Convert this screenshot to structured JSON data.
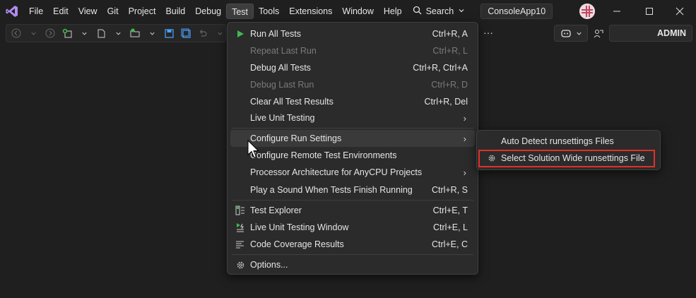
{
  "menubar": {
    "items": [
      "File",
      "Edit",
      "View",
      "Git",
      "Project",
      "Build",
      "Debug",
      "Test",
      "Tools",
      "Extensions",
      "Window",
      "Help"
    ],
    "active_item": "Test",
    "search_label": "Search",
    "solution_name": "ConsoleApp10"
  },
  "toolbar": {
    "account_label": "ADMIN",
    "more_label": "···"
  },
  "test_menu": {
    "items": [
      {
        "label": "Run All Tests",
        "shortcut": "Ctrl+R, A",
        "icon": "run-icon",
        "disabled": false
      },
      {
        "label": "Repeat Last Run",
        "shortcut": "Ctrl+R, L",
        "disabled": true
      },
      {
        "label": "Debug All Tests",
        "shortcut": "Ctrl+R, Ctrl+A",
        "disabled": false
      },
      {
        "label": "Debug Last Run",
        "shortcut": "Ctrl+R, D",
        "disabled": true
      },
      {
        "label": "Clear All Test Results",
        "shortcut": "Ctrl+R, Del",
        "disabled": false
      },
      {
        "label": "Live Unit Testing",
        "shortcut": "",
        "submenu": true
      },
      {
        "label": "Configure Run Settings",
        "shortcut": "",
        "submenu": true,
        "hovered": true
      },
      {
        "label": "Configure Remote Test Environments",
        "shortcut": ""
      },
      {
        "label": "Processor Architecture for AnyCPU Projects",
        "shortcut": "",
        "submenu": true
      },
      {
        "label": "Play a Sound When Tests Finish Running",
        "shortcut": "Ctrl+R, S"
      },
      {
        "label": "Test Explorer",
        "shortcut": "Ctrl+E, T",
        "icon": "test-explorer-icon"
      },
      {
        "label": "Live Unit Testing Window",
        "shortcut": "Ctrl+E, L",
        "icon": "live-unit-testing-icon"
      },
      {
        "label": "Code Coverage Results",
        "shortcut": "Ctrl+E, C",
        "icon": "code-coverage-icon"
      },
      {
        "label": "Options...",
        "shortcut": "",
        "icon": "gear-icon"
      }
    ]
  },
  "run_settings_submenu": {
    "items": [
      {
        "label": "Auto Detect runsettings Files"
      },
      {
        "label": "Select Solution Wide runsettings File",
        "icon": "gear-icon",
        "highlighted": true
      }
    ]
  },
  "colors": {
    "background": "#1f1f1f",
    "menu_background": "#2b2b2b",
    "hover": "#3a3a3a",
    "highlight_border": "#e0302a",
    "accent_green": "#3fb950",
    "vs_purple": "#a87ce0"
  }
}
